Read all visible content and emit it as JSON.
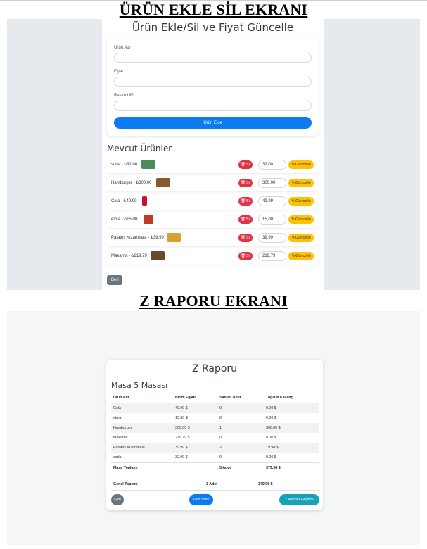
{
  "headings": {
    "screen1": "ÜRÜN EKLE SİL EKRANI",
    "screen2": "Z RAPORU EKRANI"
  },
  "product_screen": {
    "title": "Ürün Ekle/Sil ve Fiyat Güncelle",
    "form": {
      "name_label": "Ürün Adı",
      "price_label": "Fiyat",
      "image_label": "Resim URL",
      "name_value": "",
      "price_value": "",
      "image_value": "",
      "add_button": "Ürün Ekle"
    },
    "list_title": "Mevcut Ürünler",
    "delete_label": "Sil",
    "update_label": "Güncelle",
    "delete_icon": "trash-icon",
    "update_icon": "edit-icon",
    "products": [
      {
        "label": "soda - ₺32.00",
        "price": "32,00",
        "thumb": "soda-image",
        "thumb_color": "#4a8c5a"
      },
      {
        "label": "Hamburger - ₺300.00",
        "price": "300,00",
        "thumb": "hamburger-image",
        "thumb_color": "#8a5a2b"
      },
      {
        "label": "Cola - ₺49.99",
        "price": "49.99",
        "thumb": "cola-image",
        "thumb_color": "#c8102e"
      },
      {
        "label": "elma - ₺15.00",
        "price": "15,00",
        "thumb": "apple-image",
        "thumb_color": "#c0392b"
      },
      {
        "label": "Patates Kızartması - ₺39.99",
        "price": "39,99",
        "thumb": "fries-image",
        "thumb_color": "#d9a032"
      },
      {
        "label": "Makarna - ₺219.79",
        "price": "219,79",
        "thumb": "pasta-image",
        "thumb_color": "#6b4a2a"
      }
    ],
    "back_button": "Geri"
  },
  "z_report": {
    "title": "Z Raporu",
    "table_title": "Masa 5 Masası",
    "columns": [
      "Ürün Adı",
      "Birim Fiyatı",
      "Satılan Adet",
      "Toplam Kazanç"
    ],
    "rows": [
      [
        "Cola",
        "49.99 $",
        "0",
        "0.00 $"
      ],
      [
        "elma",
        "15.00 $",
        "0",
        "0.00 $"
      ],
      [
        "Hamburger",
        "300.00 $",
        "1",
        "300.00 $"
      ],
      [
        "Makarna",
        "219.79 $",
        "0",
        "0.00 $"
      ],
      [
        "Patates Kızartması",
        "39.99 $",
        "2",
        "79.98 $"
      ],
      [
        "soda",
        "32.00 $",
        "0",
        "0.00 $"
      ]
    ],
    "table_total": {
      "label": "Masa Toplamı",
      "count": "3 Adet",
      "amount": "379.98 $"
    },
    "grand_total": {
      "label": "Genel Toplam",
      "count": "3 Adet",
      "amount": "379.98 $"
    },
    "buttons": {
      "back": "Geri",
      "end_of_day": "Gün Sonu",
      "send_report": "Z Raporu Geçmişi"
    }
  }
}
